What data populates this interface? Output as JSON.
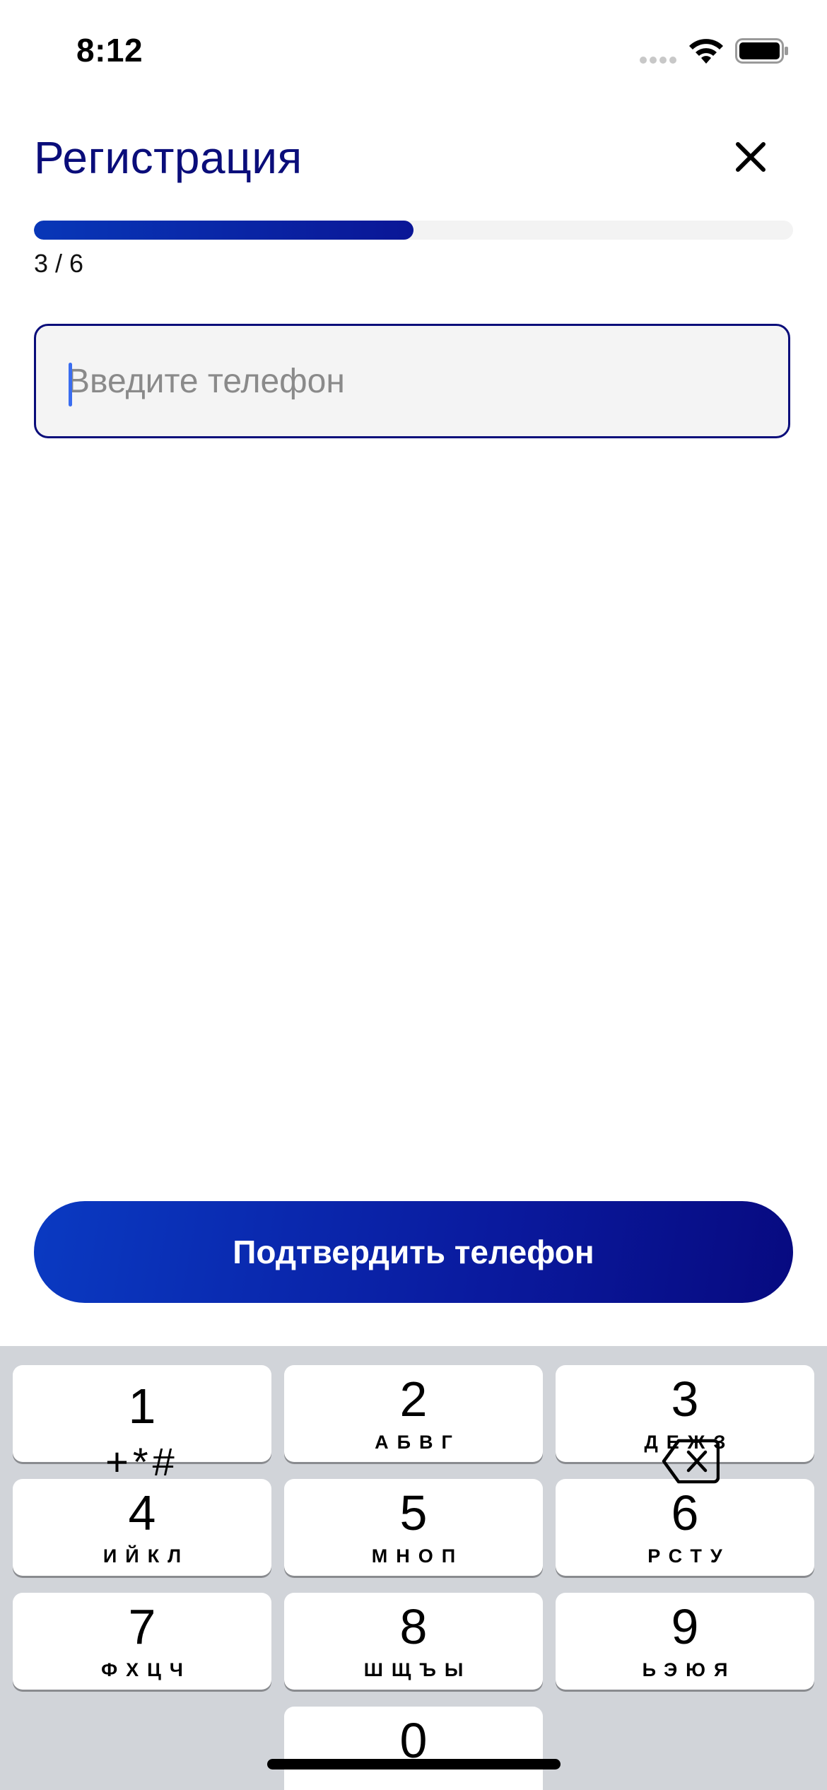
{
  "status_bar": {
    "time": "8:12",
    "icons": [
      "cellular-signal-icon",
      "wifi-icon",
      "battery-icon"
    ]
  },
  "header": {
    "title": "Регистрация",
    "close_icon": "close-icon"
  },
  "progress": {
    "current_step": 3,
    "total_steps": 6,
    "label": "3 / 6",
    "fraction": 0.5
  },
  "phone_field": {
    "placeholder": "Введите телефон",
    "value": ""
  },
  "confirm_button": {
    "label": "Подтвердить телефон"
  },
  "keypad": {
    "keys": [
      {
        "digit": "1",
        "letters": ""
      },
      {
        "digit": "2",
        "letters": "АБВГ"
      },
      {
        "digit": "3",
        "letters": "ДЕЖЗ"
      },
      {
        "digit": "4",
        "letters": "ИЙКЛ"
      },
      {
        "digit": "5",
        "letters": "МНОП"
      },
      {
        "digit": "6",
        "letters": "РСТУ"
      },
      {
        "digit": "7",
        "letters": "ФХЦЧ"
      },
      {
        "digit": "8",
        "letters": "ШЩЪЫ"
      },
      {
        "digit": "9",
        "letters": "ЬЭЮЯ"
      },
      {
        "digit": "0",
        "letters": ""
      }
    ],
    "symbols_key": "+*#",
    "delete_icon": "backspace-icon"
  },
  "colors": {
    "accent": "#0a0d7a",
    "button_gradient_start": "#0a3ac2",
    "button_gradient_end": "#070a80",
    "progress_track": "#f3f3f3",
    "keypad_background": "#d1d4d9",
    "caret": "#3a6df0"
  }
}
